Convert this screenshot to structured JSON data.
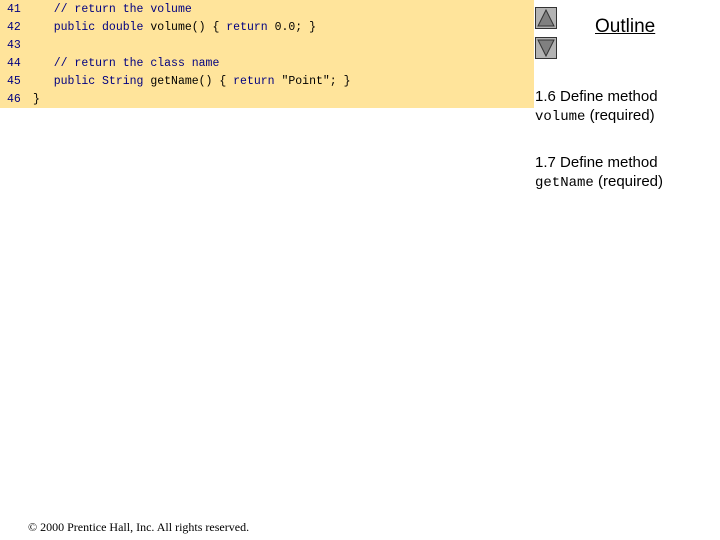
{
  "code": {
    "lines": [
      {
        "num": "41",
        "comment": "// return the volume",
        "code": ""
      },
      {
        "num": "42",
        "pre": "public double",
        "code": " volume() { ",
        "kw2": "return",
        "post": " 0.0; }"
      },
      {
        "num": "43"
      },
      {
        "num": "44",
        "comment": "// return the class name"
      },
      {
        "num": "45",
        "pre": "public String",
        "code": " getName() { ",
        "kw2": "return",
        "post": " \"Point\"; }"
      },
      {
        "num": "46",
        "brace": "}"
      }
    ]
  },
  "outline": {
    "title": "Outline",
    "notes": [
      {
        "prefix": "1.6 Define method",
        "code": "volume",
        "suffix": " (required)"
      },
      {
        "prefix": "1.7 Define method",
        "code": "getName",
        "suffix": " (required)"
      }
    ]
  },
  "footer": {
    "text": "© 2000 Prentice Hall, Inc.  All rights reserved."
  },
  "colors": {
    "code_bg": "#ffe49b",
    "keyword": "#000080",
    "nav_button": "#b3b3b3"
  },
  "icons": {
    "up": "triangle-up-icon",
    "down": "triangle-down-icon"
  }
}
